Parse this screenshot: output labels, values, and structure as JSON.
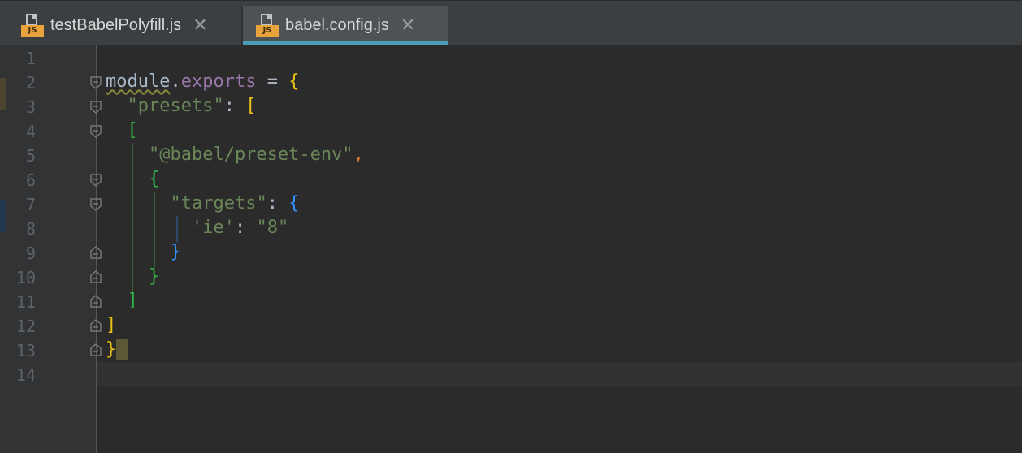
{
  "tabs": [
    {
      "icon": "js-file-icon",
      "icon_badge": "JS",
      "label": "testBabelPolyfill.js",
      "active": false
    },
    {
      "icon": "js-file-icon",
      "icon_badge": "JS",
      "label": "babel.config.js",
      "active": true
    }
  ],
  "tab_close_glyph": "✕",
  "accent_color": "#4a9eb5",
  "editor": {
    "line_numbers": [
      "1",
      "2",
      "3",
      "4",
      "5",
      "6",
      "7",
      "8",
      "9",
      "10",
      "11",
      "12",
      "13",
      "14"
    ],
    "lines": {
      "l2": {
        "a": "module",
        "b": ".",
        "c": "exports",
        "d": " = ",
        "e": "{"
      },
      "l3": {
        "a": "\"presets\"",
        "b": ": ",
        "c": "["
      },
      "l4": {
        "a": "["
      },
      "l5": {
        "a": "\"@babel/preset-env\"",
        "b": ","
      },
      "l6": {
        "a": "{"
      },
      "l7": {
        "a": "\"targets\"",
        "b": ": ",
        "c": "{"
      },
      "l8": {
        "a": "'ie'",
        "b": ": ",
        "c": "\"8\""
      },
      "l9": {
        "a": "}"
      },
      "l10": {
        "a": "}"
      },
      "l11": {
        "a": "]"
      },
      "l12": {
        "a": "]"
      },
      "l13": {
        "a": "}"
      }
    }
  }
}
